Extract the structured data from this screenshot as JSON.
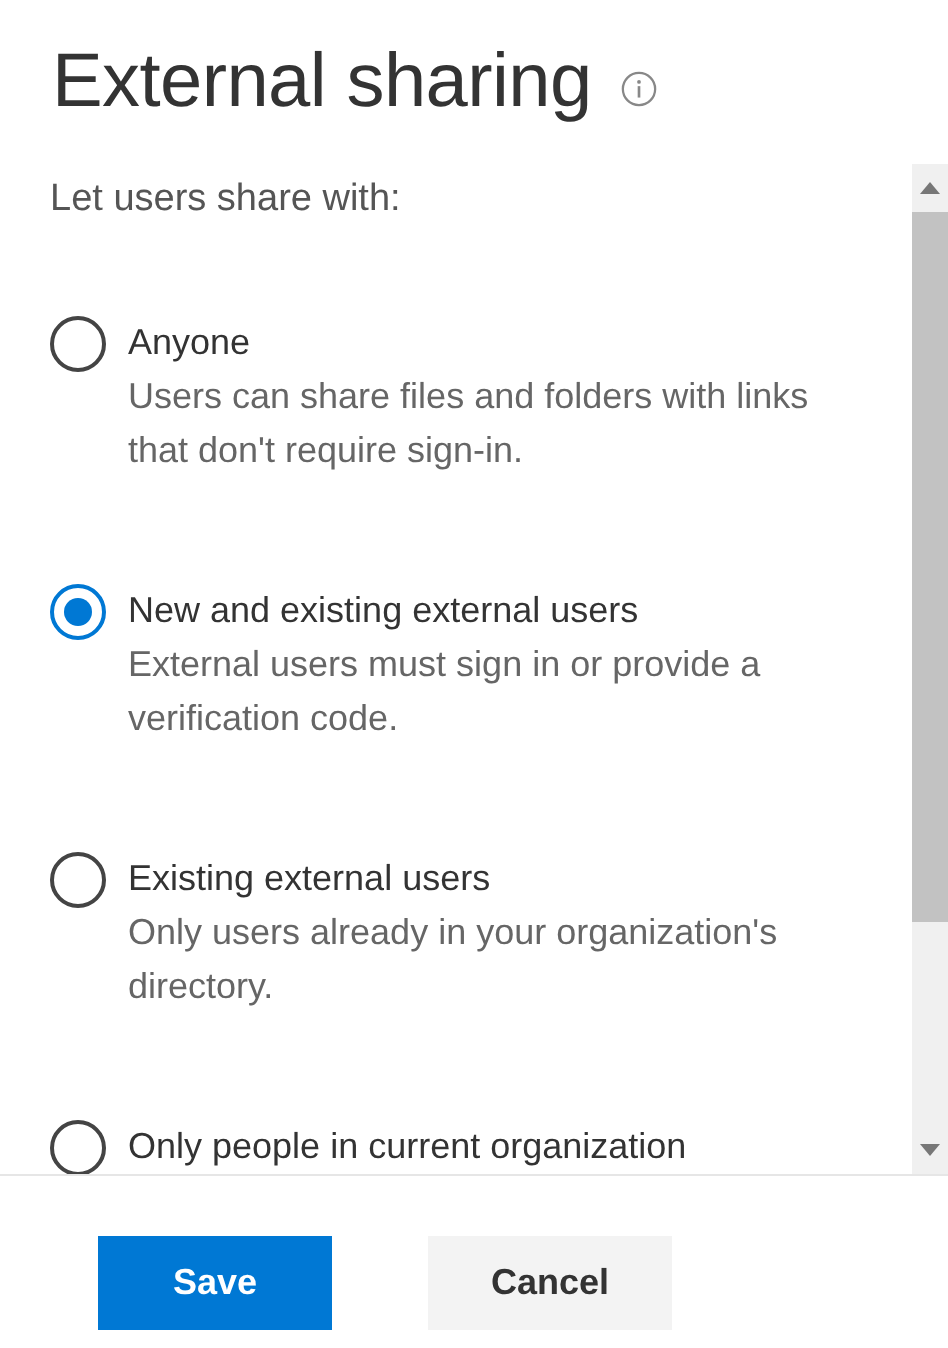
{
  "panel": {
    "title": "External sharing"
  },
  "prompt": "Let users share with:",
  "options": [
    {
      "label": "Anyone",
      "description": "Users can share files and folders with links that don't require sign-in.",
      "selected": false
    },
    {
      "label": "New and existing external users",
      "description": "External users must sign in or provide a verification code.",
      "selected": true
    },
    {
      "label": "Existing external users",
      "description": "Only users already in your organization's directory.",
      "selected": false
    },
    {
      "label": "Only people in current organization",
      "selected": false
    }
  ],
  "buttons": [
    {
      "label": "Save",
      "kind": "primary"
    },
    {
      "label": "Cancel",
      "kind": "secondary"
    }
  ]
}
